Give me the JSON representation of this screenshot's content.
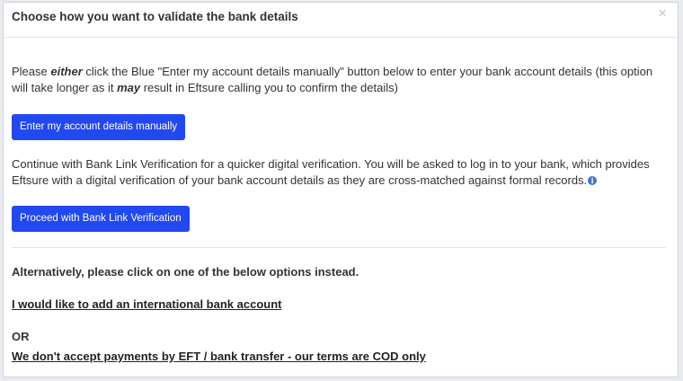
{
  "modal": {
    "title": "Choose how you want to validate the bank details",
    "close_glyph": "×"
  },
  "manual": {
    "text_prefix": "Please ",
    "text_either": "either",
    "text_middle": " click the Blue \"Enter my account details manually\" button below to enter your bank account details (this option will take longer as it ",
    "text_may": "may",
    "text_suffix": " result in Eftsure calling you to confirm the details)",
    "button_label": "Enter my account details manually"
  },
  "bank_link": {
    "text": "Continue with Bank Link Verification for a quicker digital verification. You will be asked to log in to your bank, which provides Eftsure with a digital verification of your bank account details as they are cross-matched against formal records.",
    "info_icon": "info-icon",
    "button_label": "Proceed with Bank Link Verification"
  },
  "alternatives": {
    "heading": "Alternatively, please click on one of the below options instead.",
    "international_link": "I would like to add an international bank account",
    "or_label": "OR",
    "cod_link": "We don't accept payments by EFT / bank transfer - our terms are COD only"
  },
  "colors": {
    "primary_button": "#2248f0",
    "info_icon": "#3d78c9"
  }
}
